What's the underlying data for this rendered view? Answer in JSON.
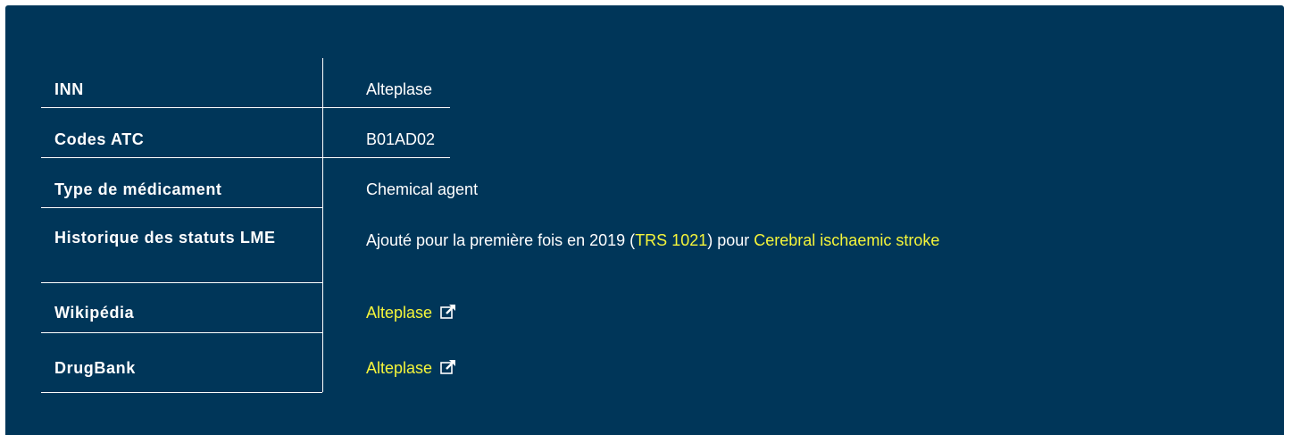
{
  "rows": {
    "inn": {
      "label": "INN",
      "value": "Alteplase"
    },
    "atc": {
      "label": "Codes ATC",
      "value": "B01AD02"
    },
    "type": {
      "label": "Type de médicament",
      "value": "Chemical agent"
    },
    "history": {
      "label": "Historique des statuts LME",
      "prefix": "Ajouté pour la première fois en 2019 (",
      "trs_link": "TRS 1021",
      "middle": ") pour ",
      "indication_link": "Cerebral ischaemic stroke"
    },
    "wikipedia": {
      "label": "Wikipédia",
      "link": "Alteplase",
      "icon": "external-link-icon"
    },
    "drugbank": {
      "label": "DrugBank",
      "link": "Alteplase",
      "icon": "external-link-icon"
    }
  },
  "colors": {
    "background": "#003659",
    "text": "#ffffff",
    "link": "#f5f53a"
  }
}
